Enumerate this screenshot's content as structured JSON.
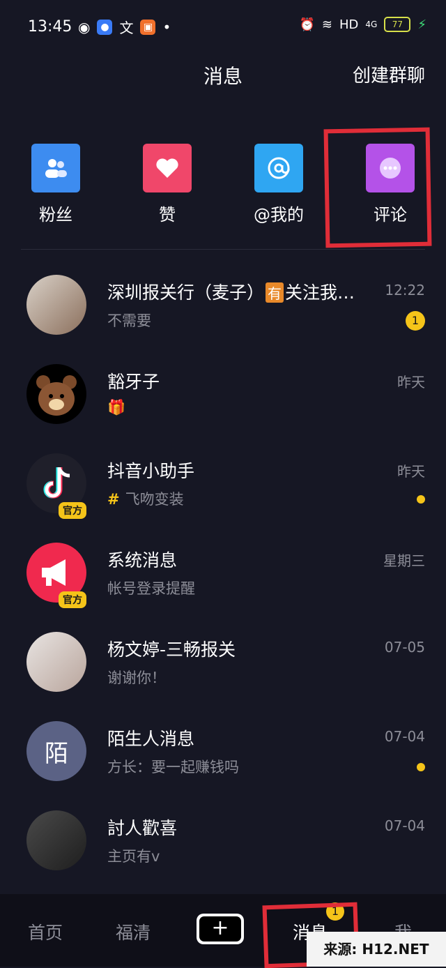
{
  "status": {
    "time": "13:45",
    "network": "HD",
    "signal": "4G",
    "battery": "77"
  },
  "header": {
    "title": "消息",
    "create_group": "创建群聊"
  },
  "quick_actions": [
    {
      "label": "粉丝",
      "icon": "fans-icon",
      "color": "#3d8cf0"
    },
    {
      "label": "赞",
      "icon": "heart-icon",
      "color": "#f0476a"
    },
    {
      "label": "@我的",
      "icon": "at-icon",
      "color": "#2fa6f2"
    },
    {
      "label": "评论",
      "icon": "comment-icon",
      "color": "#b452e8"
    }
  ],
  "conversations": [
    {
      "name": "深圳报关行（麦子）",
      "tag": "有",
      "name_suffix": "关注我…",
      "preview": "不需要",
      "time": "12:22",
      "unread": "1"
    },
    {
      "name": "豁牙子",
      "preview": "🎁",
      "time": "昨天"
    },
    {
      "name": "抖音小助手",
      "preview": "飞吻变装",
      "time": "昨天",
      "official": "官方"
    },
    {
      "name": "系统消息",
      "preview": "帐号登录提醒",
      "time": "星期三",
      "official": "官方"
    },
    {
      "name": "杨文婷-三畅报关",
      "preview": "谢谢你！",
      "time": "07-05"
    },
    {
      "name": "陌生人消息",
      "avatar_text": "陌",
      "preview": "方长：要一起赚钱吗",
      "time": "07-04"
    },
    {
      "name": "討人歡喜",
      "preview": "主页有v",
      "time": "07-04"
    }
  ],
  "tabs": {
    "home": "首页",
    "city": "福清",
    "plus": "+",
    "messages": "消息",
    "messages_badge": "1",
    "me": "我"
  },
  "watermark": "来源: H12.NET"
}
